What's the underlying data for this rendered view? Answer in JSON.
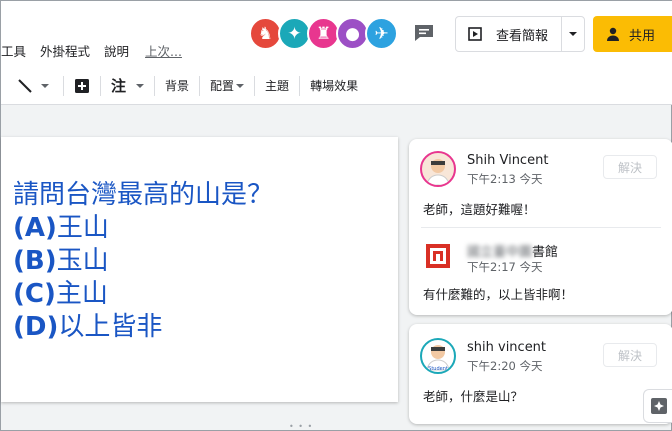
{
  "menu": [
    "工具",
    "外掛程式",
    "說明"
  ],
  "last_edit": "上次...",
  "collaborators": [
    {
      "icon": "horse-icon",
      "color": "#e5483c",
      "glyph": "♞"
    },
    {
      "icon": "dragon-icon",
      "color": "#1ba8b8",
      "glyph": "✦"
    },
    {
      "icon": "llama-icon",
      "color": "#e8368f",
      "glyph": "♜"
    },
    {
      "icon": "pig-icon",
      "color": "#9c4fc5",
      "glyph": "●"
    },
    {
      "icon": "airplane-icon",
      "color": "#2da2e0",
      "glyph": "✈"
    }
  ],
  "present_label": "查看簡報",
  "share_label": "共用",
  "toolbar": {
    "note_label": "注",
    "background_label": "背景",
    "layout_label": "配置",
    "theme_label": "主題",
    "transition_label": "轉場效果"
  },
  "slide": {
    "question": "請問台灣最高的山是？",
    "options": [
      {
        "letter": "(A)",
        "text": "王山"
      },
      {
        "letter": "(B)",
        "text": "玉山"
      },
      {
        "letter": "(C)",
        "text": "主山"
      },
      {
        "letter": "(D)",
        "text": "以上皆非"
      }
    ]
  },
  "threads": [
    {
      "resolve_label": "解決",
      "comments": [
        {
          "author": "Shih Vincent",
          "time": "下午2:13 今天",
          "text": "老師，這題好難喔！"
        },
        {
          "author_blurred": "國立臺中圖",
          "author_suffix": "書館",
          "time": "下午2:17 今天",
          "text": "有什麼難的，以上皆非啊！"
        }
      ]
    },
    {
      "resolve_label": "解決",
      "comments": [
        {
          "author": "shih vincent",
          "time": "下午2:20 今天",
          "text": "老師，什麼是山？",
          "badge": "Student"
        }
      ]
    }
  ]
}
